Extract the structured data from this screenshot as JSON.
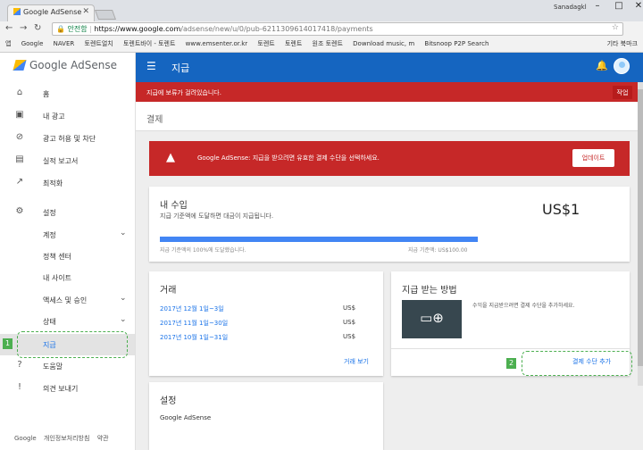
{
  "browser": {
    "tab_title": "Google AdSense",
    "tab_close": "✕",
    "user_name": "Sanadagkl",
    "secure_label": "안전함",
    "url_host": "https://www.google.com",
    "url_path": "/adsense/new/u/0/pub-6211309614017418/payments",
    "bookmarks": [
      "앱",
      "Google",
      "NAVER",
      "토렌트얼치",
      "토렌트바이 - 토렌트",
      "www.emsenter.or.kr",
      "토렌트",
      "토렌트",
      "원조 토렌트",
      "Download music, m",
      "Bitsnoop P2P Search"
    ],
    "bookmarks_right": "기타 북마크"
  },
  "sidebar": {
    "logo_text": "Google AdSense",
    "items": [
      {
        "label": "홈",
        "icon": "home-icon"
      },
      {
        "label": "내 광고",
        "icon": "ads-icon"
      },
      {
        "label": "광고 허용 및 차단",
        "icon": "block-icon"
      },
      {
        "label": "실적 보고서",
        "icon": "reports-icon"
      },
      {
        "label": "최적화",
        "icon": "trend-icon"
      },
      {
        "label": "설정",
        "icon": "gear-icon"
      },
      {
        "label": "계정"
      },
      {
        "label": "정책 센터"
      },
      {
        "label": "내 사이트"
      },
      {
        "label": "액세스 및 승인"
      },
      {
        "label": "상태"
      },
      {
        "label": "지급"
      },
      {
        "label": "도움말",
        "icon": "help-icon"
      },
      {
        "label": "의견 보내기",
        "icon": "feedback-icon"
      }
    ],
    "footer": [
      "Google",
      "개인정보처리방침",
      "약관"
    ]
  },
  "appbar": {
    "title": "지급"
  },
  "alert": {
    "text": "지급에 보류가 걸려있습니다.",
    "action": "작업"
  },
  "page": {
    "title": "결제"
  },
  "banner": {
    "text": "Google AdSense: 지급을 받으려면 유효한 결제 수단을 선택하세요.",
    "button": "업데이트"
  },
  "earnings": {
    "title": "내 수입",
    "subtitle": "지급 기준액에 도달하면 대금이 지급됩니다.",
    "amount": "US$1",
    "progress_percent": 100,
    "progress_left": "지급 기준액의 100%에 도달했습니다.",
    "progress_right": "지급 기준액: US$100.00"
  },
  "transactions": {
    "title": "거래",
    "rows": [
      {
        "date": "2017년 12월 1일~3일",
        "value": "US$"
      },
      {
        "date": "2017년 11월 1일~30일",
        "value": "US$"
      },
      {
        "date": "2017년 10월 1일~31일",
        "value": "US$"
      }
    ],
    "more": "거래 보기"
  },
  "payment_method": {
    "title": "지급 받는 방법",
    "description": "수익을 지급받으려면 결제 수단을 추가하세요.",
    "add_link": "결제 수단 추가"
  },
  "settings_card": {
    "title": "설정",
    "item": "Google AdSense"
  },
  "callouts": [
    "1",
    "2"
  ],
  "colors": {
    "appbar": "#1565c0",
    "alert": "#c62828",
    "link": "#1a73e8",
    "callout": "#4caf50"
  }
}
